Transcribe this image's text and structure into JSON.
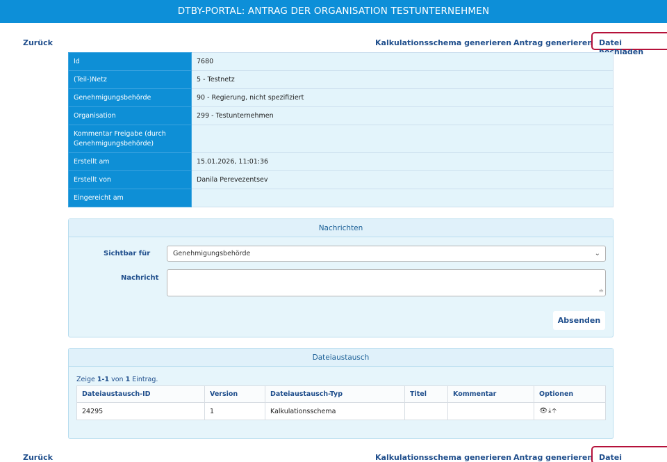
{
  "header": {
    "title": "DTBY-PORTAL: ANTRAG DER ORGANISATION TESTUNTERNEHMEN"
  },
  "nav": {
    "back": "Zurück",
    "calc": "Kalkulationsschema generieren",
    "application": "Antrag generieren",
    "upload": "Datei hochladen"
  },
  "details": [
    {
      "label": "Id",
      "value": "7680"
    },
    {
      "label": "(Teil-)Netz",
      "value": "5 - Testnetz"
    },
    {
      "label": "Genehmigungsbehörde",
      "value": "90 - Regierung, nicht spezifiziert"
    },
    {
      "label": "Organisation",
      "value": "299 - Testunternehmen"
    },
    {
      "label": "Kommentar Freigabe (durch Genehmigungsbehörde)",
      "value": ""
    },
    {
      "label": "Erstellt am",
      "value": "15.01.2026, 11:01:36"
    },
    {
      "label": "Erstellt von",
      "value": "Danila Perevezentsev"
    },
    {
      "label": "Eingereicht am",
      "value": ""
    }
  ],
  "messages": {
    "title": "Nachrichten",
    "visible_label": "Sichtbar für",
    "visible_value": "Genehmigungsbehörde",
    "message_label": "Nachricht",
    "message_value": "",
    "submit": "Absenden"
  },
  "files": {
    "title": "Dateiaustausch",
    "summary_prefix": "Zeige ",
    "summary_range": "1-1",
    "summary_mid": " von ",
    "summary_count": "1",
    "summary_suffix": " Eintrag.",
    "columns": [
      "Dateiaustausch-ID",
      "Version",
      "Dateiaustausch-Typ",
      "Titel",
      "Kommentar",
      "Optionen"
    ],
    "rows": [
      {
        "id": "24295",
        "version": "1",
        "type": "Kalkulationsschema",
        "title": "",
        "comment": ""
      }
    ],
    "option_icons": [
      "eye-icon",
      "download-icon",
      "upload-arrow-icon"
    ]
  }
}
